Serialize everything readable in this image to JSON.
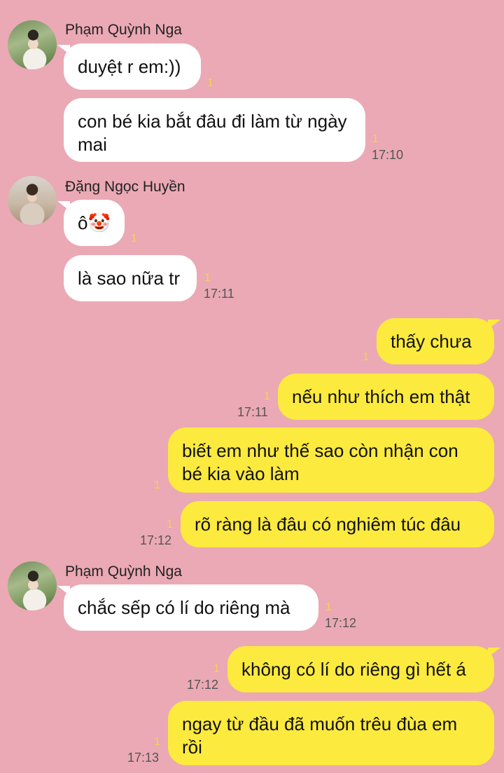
{
  "groups": [
    {
      "sender": "Phạm Quỳnh Nga",
      "messages": [
        {
          "text": "duyệt r em:))",
          "unread": "1",
          "time": ""
        },
        {
          "text": "con bé kia bắt đâu đi làm từ ngày mai",
          "unread": "1",
          "time": "17:10"
        }
      ]
    },
    {
      "sender": "Đặng Ngọc Huyền",
      "messages": [
        {
          "text": "ô🤡",
          "unread": "1",
          "time": ""
        },
        {
          "text": "là sao nữa tr",
          "unread": "1",
          "time": "17:11"
        }
      ]
    },
    {
      "sender": "",
      "messages": [
        {
          "text": "thấy chưa",
          "unread": "1",
          "time": ""
        },
        {
          "text": "nếu như thích em thật",
          "unread": "1",
          "time": "17:11"
        },
        {
          "text": "biết em như thế sao còn nhận con bé kia vào làm",
          "unread": "1",
          "time": ""
        },
        {
          "text": "rõ ràng là đâu có nghiêm túc đâu",
          "unread": "1",
          "time": "17:12"
        }
      ]
    },
    {
      "sender": "Phạm Quỳnh Nga",
      "messages": [
        {
          "text": "chắc sếp có lí do riêng mà",
          "unread": "1",
          "time": "17:12"
        }
      ]
    },
    {
      "sender": "",
      "messages": [
        {
          "text": "không có lí do riêng gì hết á",
          "unread": "1",
          "time": "17:12"
        },
        {
          "text": "ngay từ đầu đã muốn trêu đùa em rồi",
          "unread": "1",
          "time": "17:13"
        }
      ]
    }
  ],
  "colors": {
    "background": "#eaa9b4",
    "incoming_bubble": "#ffffff",
    "outgoing_bubble": "#fcea3e",
    "unread_count": "#f2d44a",
    "timestamp": "#555555"
  },
  "icons": {
    "avatar_1": "avatar-photo",
    "avatar_2": "avatar-photo",
    "emoji": "clown-face"
  }
}
